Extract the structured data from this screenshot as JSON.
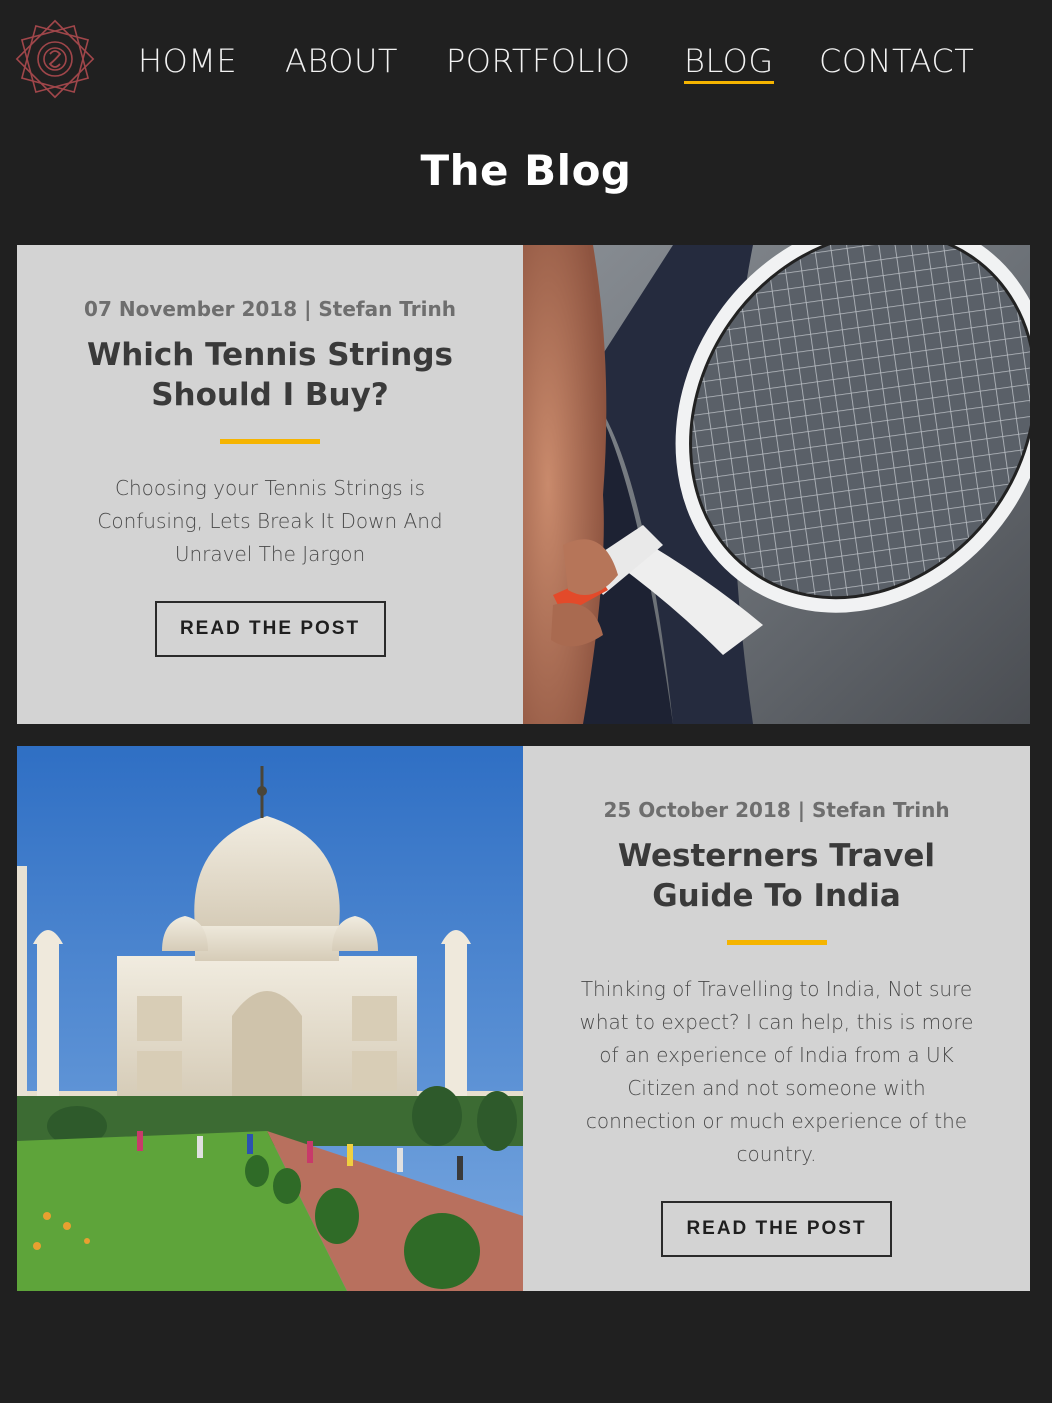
{
  "nav": {
    "items": [
      {
        "label": "HOME"
      },
      {
        "label": "ABOUT"
      },
      {
        "label": "PORTFOLIO"
      },
      {
        "label": "BLOG"
      },
      {
        "label": "CONTACT"
      }
    ],
    "active": "BLOG"
  },
  "page": {
    "title": "The Blog"
  },
  "posts": [
    {
      "meta": "07 November 2018 | Stefan Trinh",
      "title": "Which Tennis Strings Should I Buy?",
      "excerpt": "Choosing your Tennis Strings is Confusing, Lets Break It Down And Unravel The Jargon",
      "button": "READ THE POST",
      "image": "tennis-racket-photo"
    },
    {
      "meta": "25 October 2018 | Stefan Trinh",
      "title": "Westerners Travel Guide To India",
      "excerpt": "Thinking of Travelling to India, Not sure what to expect? I can help, this is more of an experience of India from a UK Citizen and not someone with connection or much experience of the country.",
      "button": "READ THE POST",
      "image": "taj-mahal-photo"
    }
  ],
  "colors": {
    "background": "#202020",
    "card": "#d3d3d3",
    "accent": "#f5b400",
    "logo": "#a0464a"
  }
}
